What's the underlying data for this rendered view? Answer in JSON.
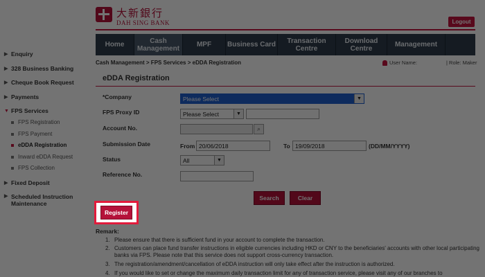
{
  "header": {
    "logo_cn": "大新銀行",
    "logo_en": "DAH SING BANK",
    "logout_label": "Logout"
  },
  "nav": {
    "items": [
      {
        "label": "Home"
      },
      {
        "label": "Cash Management"
      },
      {
        "label": "MPF"
      },
      {
        "label": "Business Card"
      },
      {
        "label": "Transaction Centre"
      },
      {
        "label": "Download Centre"
      },
      {
        "label": "Management"
      }
    ]
  },
  "sidebar": {
    "items": [
      {
        "label": "Enquiry"
      },
      {
        "label": "328 Business Banking"
      },
      {
        "label": "Cheque Book Request"
      },
      {
        "label": "Payments"
      },
      {
        "label": "FPS Services"
      },
      {
        "label": "Fixed Deposit"
      },
      {
        "label": "Scheduled Instruction Maintenance"
      }
    ],
    "fps_sub": [
      {
        "label": "FPS Registration"
      },
      {
        "label": "FPS Payment"
      },
      {
        "label": "eDDA Registration"
      },
      {
        "label": "Inward eDDA Request"
      },
      {
        "label": "FPS Collection"
      }
    ]
  },
  "breadcrumb": "Cash Management > FPS Services > eDDA Registration",
  "user": {
    "user_name_label": "User Name:",
    "role_label": "| Role: Maker"
  },
  "page_title": "eDDA Registration",
  "form": {
    "company_label": "*Company",
    "company_value": "Please Select",
    "proxy_label": "FPS Proxy ID",
    "proxy_value": "Please Select",
    "account_label": "Account No.",
    "date_label": "Submission Date",
    "from_label": "From",
    "from_value": "20/06/2018",
    "to_label": "To",
    "to_value": "19/09/2018",
    "date_format": "(DD/MM/YYYY)",
    "status_label": "Status",
    "status_value": "All",
    "ref_label": "Reference No."
  },
  "buttons": {
    "search": "Search",
    "clear": "Clear",
    "register": "Register"
  },
  "remarks": {
    "title": "Remark:",
    "items": [
      {
        "num": "1.",
        "text": "Please ensure that there is sufficient fund in your account to complete the transaction."
      },
      {
        "num": "2.",
        "text": "Customers can place fund transfer instructions in eligible currencies including HKD or CNY to the beneficiaries' accounts with other local participating banks via FPS. Please note that this service does not support cross-currency transaction."
      },
      {
        "num": "3.",
        "text": "The registration/amendment/cancellation of eDDA instruction will only take effect after the instruction is authorized."
      },
      {
        "num": "4.",
        "text": "If you would like to set or change the maximum daily transaction limit for any of transaction service, please visit any of our branches to"
      }
    ]
  },
  "colors": {
    "brand_red": "#b5123a",
    "nav_bg": "#2f3d4c",
    "highlight": "#e21b3c"
  }
}
